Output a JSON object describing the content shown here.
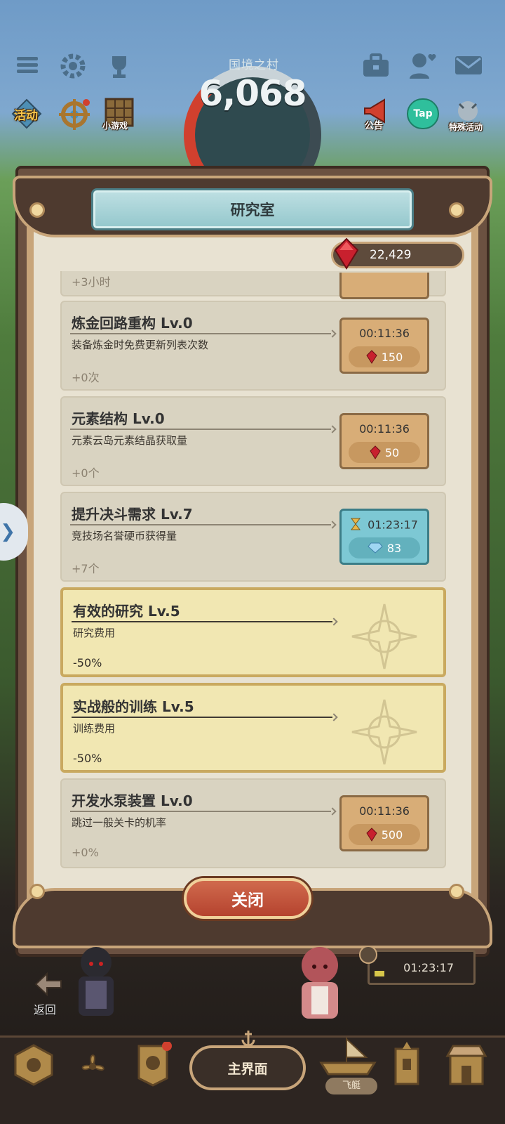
{
  "hud": {
    "village_name": "国境之村",
    "score": "6,068",
    "left_labels": {
      "activity": "活动",
      "minigame": "小游戏"
    },
    "right_labels": {
      "announcement": "公告",
      "tap": "Tap",
      "special": "特殊活动"
    }
  },
  "modal": {
    "title": "研究室",
    "currency_value": "22,429",
    "partial_item_bonus": "+3小时",
    "close_label": "关闭",
    "items": [
      {
        "title": "炼金回路重构 Lv.0",
        "desc": "装备炼金时免费更新列表次数",
        "bonus": "+0次",
        "time": "00:11:36",
        "cost": "150",
        "cost_icon": "red-gem-icon",
        "state": "available"
      },
      {
        "title": "元素结构 Lv.0",
        "desc": "元素云岛元素结晶获取量",
        "bonus": "+0个",
        "time": "00:11:36",
        "cost": "50",
        "cost_icon": "red-gem-icon",
        "state": "available"
      },
      {
        "title": "提升决斗需求 Lv.7",
        "desc": "竞技场名誉硬币获得量",
        "bonus": "+7个",
        "time": "01:23:17",
        "cost": "83",
        "cost_icon": "diamond-icon",
        "state": "in-progress"
      },
      {
        "title": "有效的研究 Lv.5",
        "desc": "研究费用",
        "bonus": "-50%",
        "state": "completed"
      },
      {
        "title": "实战般的训练 Lv.5",
        "desc": "训练费用",
        "bonus": "-50%",
        "state": "completed"
      },
      {
        "title": "开发水泵装置 Lv.0",
        "desc": "跳过一般关卡的机率",
        "bonus": "+0%",
        "time": "00:11:36",
        "cost": "500",
        "cost_icon": "red-gem-icon",
        "state": "available"
      }
    ]
  },
  "bottom": {
    "timer": "01:23:17",
    "back_label": "返回",
    "main_label": "主界面",
    "airship_label": "飞艇"
  },
  "colors": {
    "accent_red": "#d1402e",
    "panel_brown": "#6b5141",
    "teal": "#93c7cc",
    "gold": "#c8a57a"
  }
}
